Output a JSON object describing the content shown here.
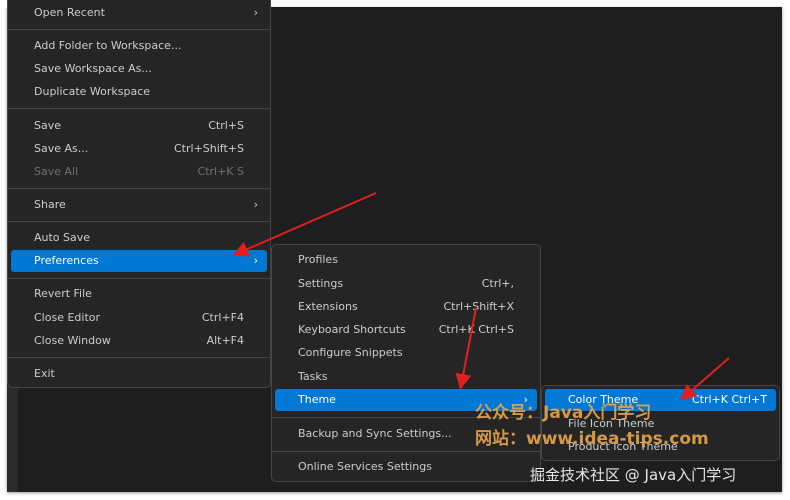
{
  "file_menu": {
    "items": [
      {
        "label": "Open Recent",
        "submenu": true
      },
      {
        "label": "Add Folder to Workspace..."
      },
      {
        "label": "Save Workspace As..."
      },
      {
        "label": "Duplicate Workspace"
      },
      {
        "label": "Save",
        "shortcut": "Ctrl+S"
      },
      {
        "label": "Save As...",
        "shortcut": "Ctrl+Shift+S"
      },
      {
        "label": "Save All",
        "shortcut": "Ctrl+K S",
        "disabled": true
      },
      {
        "label": "Share",
        "submenu": true
      },
      {
        "label": "Auto Save"
      },
      {
        "label": "Preferences",
        "submenu": true,
        "highlighted": true
      },
      {
        "label": "Revert File"
      },
      {
        "label": "Close Editor",
        "shortcut": "Ctrl+F4"
      },
      {
        "label": "Close Window",
        "shortcut": "Alt+F4"
      },
      {
        "label": "Exit"
      }
    ]
  },
  "preferences_menu": {
    "items": [
      {
        "label": "Profiles"
      },
      {
        "label": "Settings",
        "shortcut": "Ctrl+,"
      },
      {
        "label": "Extensions",
        "shortcut": "Ctrl+Shift+X"
      },
      {
        "label": "Keyboard Shortcuts",
        "shortcut": "Ctrl+K Ctrl+S"
      },
      {
        "label": "Configure Snippets"
      },
      {
        "label": "Tasks"
      },
      {
        "label": "Theme",
        "submenu": true,
        "highlighted": true
      },
      {
        "label": "Backup and Sync Settings..."
      },
      {
        "label": "Online Services Settings"
      }
    ]
  },
  "theme_menu": {
    "items": [
      {
        "label": "Color Theme",
        "shortcut": "Ctrl+K Ctrl+T",
        "highlighted": true
      },
      {
        "label": "File Icon Theme"
      },
      {
        "label": "Product Icon Theme"
      }
    ]
  },
  "watermark": {
    "line1": "公众号：Java入门学习",
    "line2": "网站：www.idea-tips.com",
    "credit": "掘金技术社区 @ Java入门学习"
  },
  "colors": {
    "highlight": "#0078d4",
    "arrow": "#e02020",
    "watermark": "#e8a54b"
  }
}
